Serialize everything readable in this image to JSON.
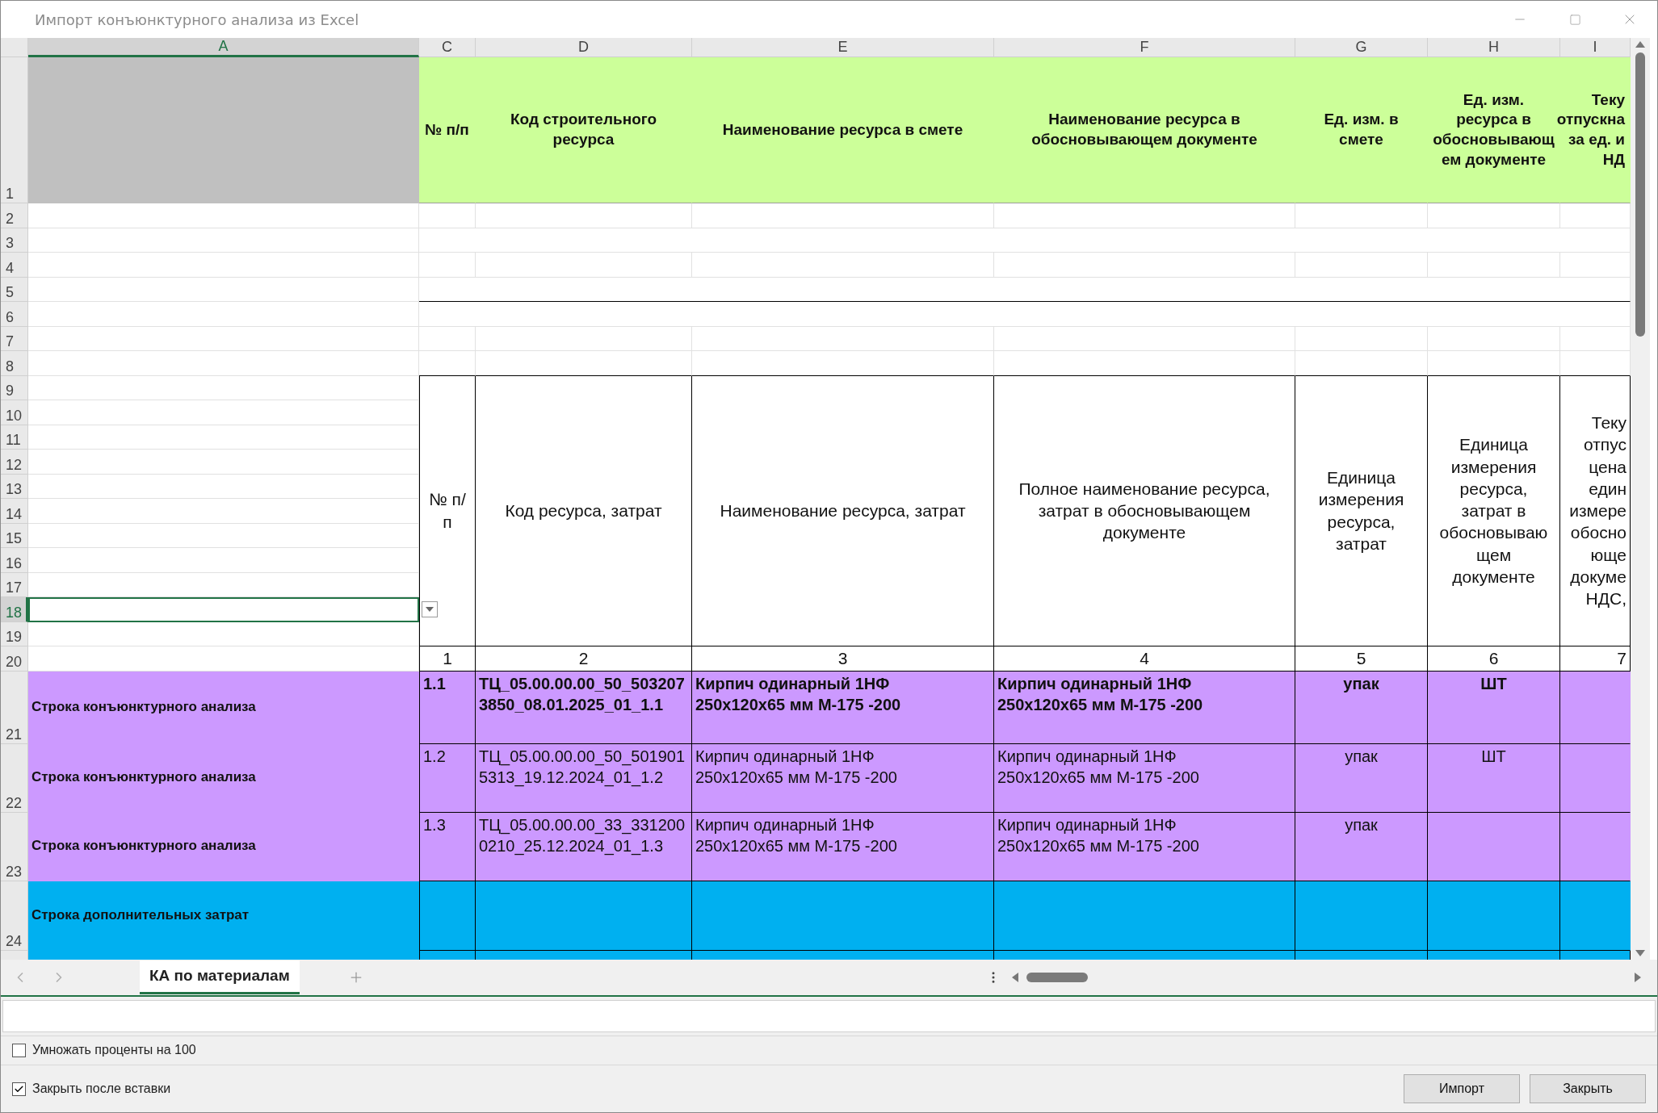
{
  "window": {
    "title": "Импорт конъюнктурного анализа из Excel"
  },
  "column_headers": [
    {
      "label": "A",
      "selected": true
    },
    {
      "label": "C",
      "selected": false
    },
    {
      "label": "D",
      "selected": false
    },
    {
      "label": "E",
      "selected": false
    },
    {
      "label": "F",
      "selected": false
    },
    {
      "label": "G",
      "selected": false
    },
    {
      "label": "H",
      "selected": false
    },
    {
      "label": "I",
      "selected": false
    }
  ],
  "row_headers": [
    {
      "label": "1",
      "selected": false
    },
    {
      "label": "2",
      "selected": false
    },
    {
      "label": "3",
      "selected": false
    },
    {
      "label": "4",
      "selected": false
    },
    {
      "label": "5",
      "selected": false
    },
    {
      "label": "6",
      "selected": false
    },
    {
      "label": "7",
      "selected": false
    },
    {
      "label": "8",
      "selected": false
    },
    {
      "label": "9",
      "selected": false
    },
    {
      "label": "10",
      "selected": false
    },
    {
      "label": "11",
      "selected": false
    },
    {
      "label": "12",
      "selected": false
    },
    {
      "label": "13",
      "selected": false
    },
    {
      "label": "14",
      "selected": false
    },
    {
      "label": "15",
      "selected": false
    },
    {
      "label": "16",
      "selected": false
    },
    {
      "label": "17",
      "selected": false
    },
    {
      "label": "18",
      "selected": true
    },
    {
      "label": "19",
      "selected": false
    },
    {
      "label": "20",
      "selected": false
    },
    {
      "label": "21",
      "selected": false
    },
    {
      "label": "22",
      "selected": false
    },
    {
      "label": "23",
      "selected": false
    },
    {
      "label": "24",
      "selected": false
    }
  ],
  "header_row": [
    "№ п/п",
    "Код строительного ресурса",
    "Наименование ресурса в смете",
    "Наименование ресурса в обосновывающем документе",
    "Ед. изм. в смете",
    "Ед. изм. ресурса в обосновывающем документе",
    "Теку\nотпускна\nза ед. и\nНД"
  ],
  "table_header": [
    "№ п/п",
    "Код ресурса, затрат",
    "Наименование ресурса, затрат",
    "Полное наименование ресурса, затрат в обосновывающем документе",
    "Единица измерения ресурса, затрат",
    "Единица измерения ресурса, затрат в обосновывающем документе",
    "Теку\nотпус\nцена\nедин\nизмере\nобосно\nюще\nдокуме\nНДС,"
  ],
  "column_numbers": [
    "1",
    "2",
    "3",
    "4",
    "5",
    "6",
    "7"
  ],
  "data_rows": [
    {
      "kind": "analysis",
      "label": "Строка конъюнктурного анализа",
      "bold": true,
      "cells": {
        "no": "1.1",
        "code": "ТЦ_05.00.00.00_50_5032073850_08.01.2025_01_1.1",
        "name": "Кирпич одинарный 1НФ\n250x120x65 мм М-175 -200",
        "full_name": "Кирпич одинарный 1НФ\n250x120x65 мм М-175 -200",
        "unit": "упак",
        "unit_doc": "ШТ"
      }
    },
    {
      "kind": "analysis",
      "label": "Строка конъюнктурного анализа",
      "bold": false,
      "cells": {
        "no": "1.2",
        "code": "ТЦ_05.00.00.00_50_5019015313_19.12.2024_01_1.2",
        "name": "Кирпич одинарный 1НФ\n250x120x65 мм М-175 -200",
        "full_name": "Кирпич одинарный 1НФ\n250x120x65 мм М-175 -200",
        "unit": "упак",
        "unit_doc": "ШТ"
      }
    },
    {
      "kind": "analysis",
      "label": "Строка конъюнктурного анализа",
      "bold": false,
      "cells": {
        "no": "1.3",
        "code": "ТЦ_05.00.00.00_33_3312000210_25.12.2024_01_1.3",
        "name": "Кирпич одинарный 1НФ\n250x120x65 мм М-175 -200",
        "full_name": "Кирпич одинарный 1НФ\n250x120x65 мм М-175 -200",
        "unit": "упак"
      }
    },
    {
      "kind": "extra",
      "label": "Строка дополнительных затрат",
      "cells": {}
    }
  ],
  "sheet_tabs": [
    {
      "label": "КА по материалам",
      "selected": true
    }
  ],
  "options": [
    {
      "label": "Умножать проценты на 100",
      "checked": false
    },
    {
      "label": "Закрыть после вставки",
      "checked": true
    }
  ],
  "buttons": [
    "Импорт",
    "Закрыть"
  ]
}
